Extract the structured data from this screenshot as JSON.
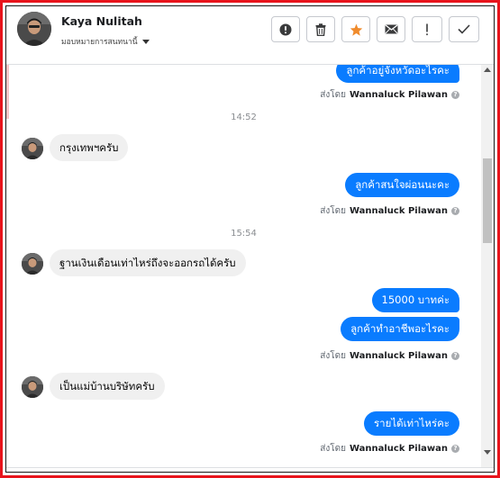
{
  "contact": {
    "name": "Kaya Nulitah",
    "assign_label": "มอบหมายการสนทนานี้"
  },
  "toolbar": {
    "buttons": [
      {
        "name": "spam-report-button",
        "icon": "exclamation-circle-icon"
      },
      {
        "name": "delete-button",
        "icon": "trash-icon"
      },
      {
        "name": "star-button",
        "icon": "star-icon",
        "color": "#f08b2c"
      },
      {
        "name": "mark-unread-button",
        "icon": "envelope-icon"
      },
      {
        "name": "follow-up-button",
        "icon": "exclamation-icon"
      },
      {
        "name": "mark-done-button",
        "icon": "check-icon"
      }
    ]
  },
  "messages": {
    "m1": {
      "text": "ลูกค้าอยู่จังหวัดอะไรคะ"
    },
    "m2": {
      "text": "กรุงเทพฯครับ"
    },
    "m3": {
      "text": "ลูกค้าสนใจผ่อนนะคะ"
    },
    "m4": {
      "text": "ฐานเงินเดือนเท่าไหร่ถึงจะออกรถได้ครับ"
    },
    "m5": {
      "text": "15000 บาทค่ะ"
    },
    "m6": {
      "text": "ลูกค้าทำอาชีพอะไรคะ"
    },
    "m7": {
      "text": "เป็นแม่บ้านบริษัทครับ"
    },
    "m8": {
      "text": "รายได้เท่าไหร่คะ"
    }
  },
  "sent_by": {
    "prefix": "ส่งโดย",
    "agent": "Wannaluck Pilawan"
  },
  "times": {
    "t1": "14:52",
    "t2": "15:54"
  },
  "colors": {
    "outgoing_bubble": "#0a7cff",
    "incoming_bubble": "#f0f0f0",
    "frame": "#e8141c"
  }
}
